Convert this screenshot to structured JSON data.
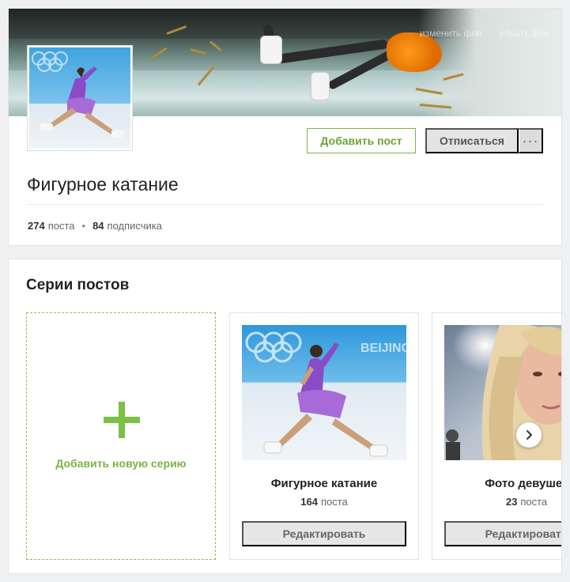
{
  "cover": {
    "buttons": [
      "изменить фон",
      "убрать фон"
    ]
  },
  "actions": {
    "add_post": "Добавить пост",
    "unsubscribe": "Отписаться",
    "more": "···"
  },
  "group": {
    "title": "Фигурное катание",
    "posts_count": "274",
    "posts_label": "поста",
    "subscribers_count": "84",
    "subscribers_label": "подписчика",
    "separator": "•"
  },
  "series": {
    "title": "Серии постов",
    "add_label": "Добавить новую серию",
    "items": [
      {
        "name": "Фигурное катание",
        "count": "164",
        "count_label": "поста",
        "edit": "Редактировать"
      },
      {
        "name": "Фото девушек",
        "count": "23",
        "count_label": "поста",
        "edit": "Редактировать"
      }
    ]
  },
  "colors": {
    "accent": "#7cb342",
    "button_gray": "#e4e4e4",
    "background": "#eef0f2"
  },
  "icons": [
    "plus-icon",
    "chevron-right-icon",
    "more-dots-icon"
  ]
}
